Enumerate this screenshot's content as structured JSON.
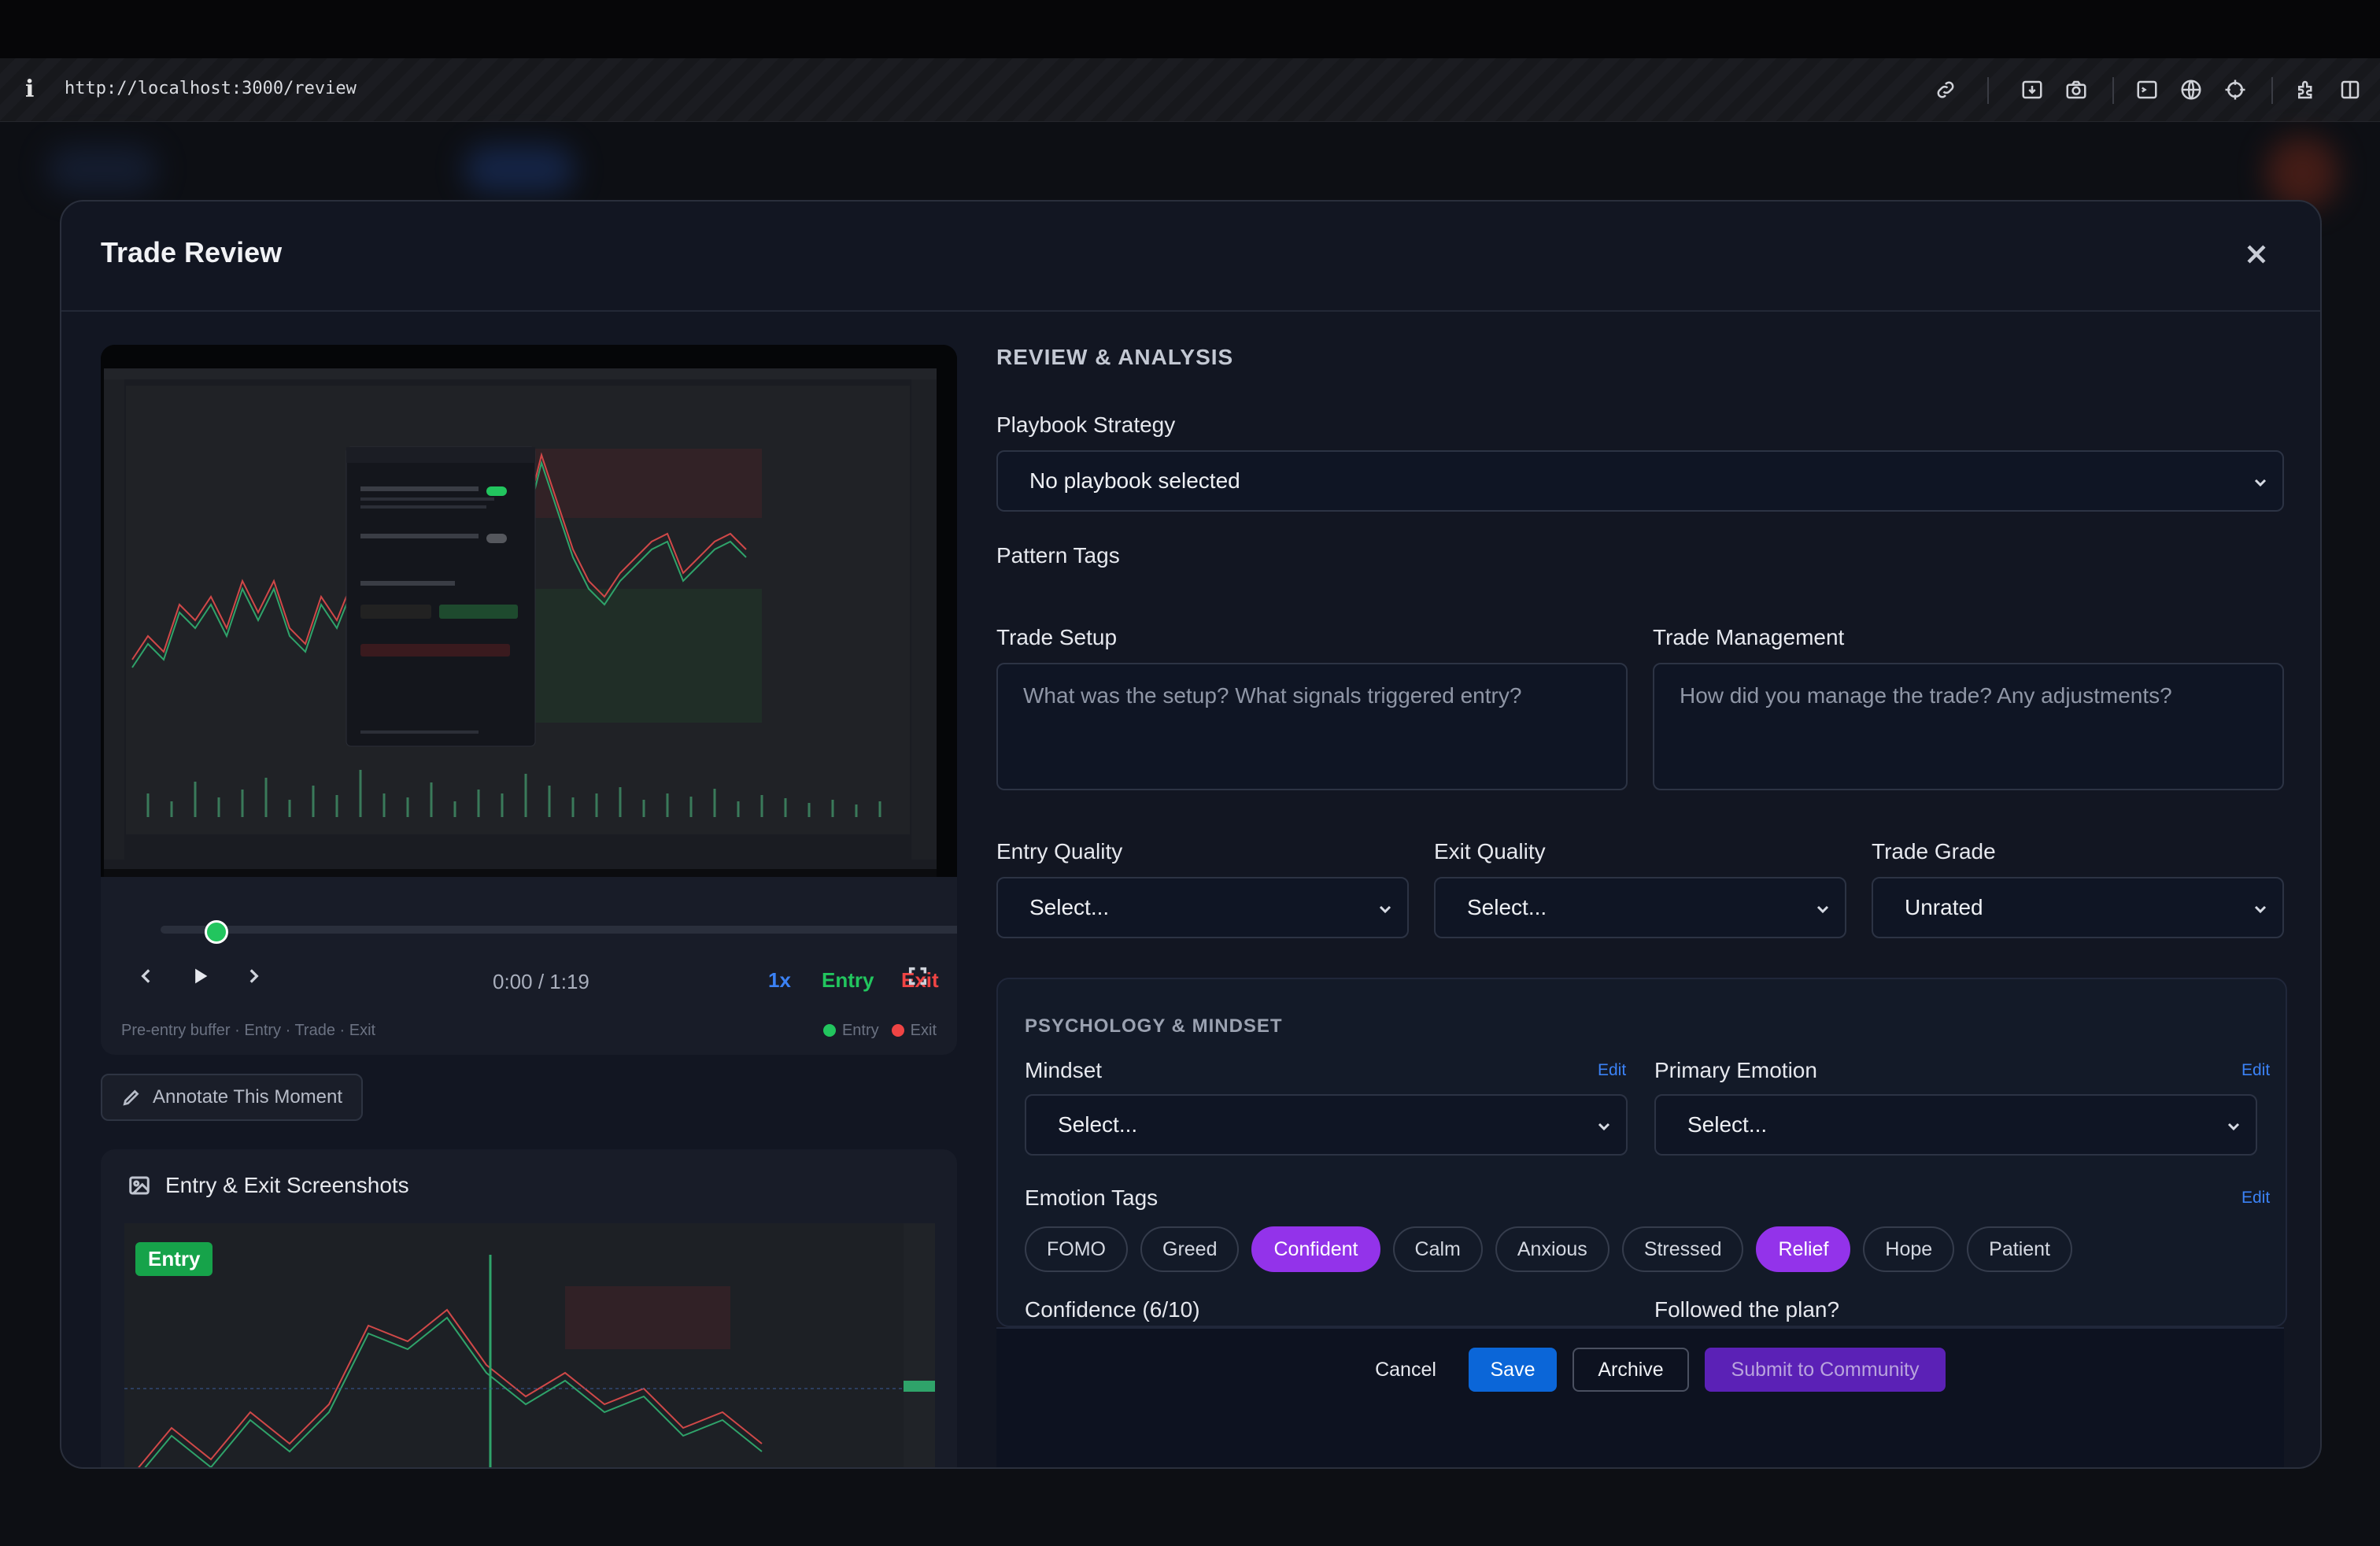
{
  "browser": {
    "info_glyph": "i",
    "url": "http://localhost:3000/review"
  },
  "modal": {
    "title": "Trade Review"
  },
  "player": {
    "time": "0:00 / 1:19",
    "speed": "1x",
    "entry_label": "Entry",
    "exit_label": "Exit",
    "caption": "Pre-entry buffer · Entry · Trade · Exit",
    "legend_entry": "Entry",
    "legend_exit": "Exit",
    "entry_color": "#22c55e",
    "exit_color": "#ef4444",
    "progress": 0
  },
  "annotate": {
    "label": "Annotate This Moment"
  },
  "screenshots": {
    "title": "Entry & Exit Screenshots",
    "entry_tag": "Entry"
  },
  "review": {
    "section_title": "REVIEW & ANALYSIS",
    "playbook": {
      "label": "Playbook Strategy",
      "value": "No playbook selected"
    },
    "pattern_tags": {
      "label": "Pattern Tags"
    },
    "trade_setup": {
      "label": "Trade Setup",
      "placeholder": "What was the setup? What signals triggered entry?"
    },
    "trade_management": {
      "label": "Trade Management",
      "placeholder": "How did you manage the trade? Any adjustments?"
    },
    "entry_quality": {
      "label": "Entry Quality",
      "value": "Select..."
    },
    "exit_quality": {
      "label": "Exit Quality",
      "value": "Select..."
    },
    "trade_grade": {
      "label": "Trade Grade",
      "value": "Unrated"
    }
  },
  "psychology": {
    "title": "PSYCHOLOGY & MINDSET",
    "mindset": {
      "label": "Mindset",
      "value": "Select...",
      "edit": "Edit"
    },
    "primary_emotion": {
      "label": "Primary Emotion",
      "value": "Select...",
      "edit": "Edit"
    },
    "emotion_tags": {
      "label": "Emotion Tags",
      "edit": "Edit",
      "tags": [
        {
          "label": "FOMO",
          "selected": false
        },
        {
          "label": "Greed",
          "selected": false
        },
        {
          "label": "Confident",
          "selected": true
        },
        {
          "label": "Calm",
          "selected": false
        },
        {
          "label": "Anxious",
          "selected": false
        },
        {
          "label": "Stressed",
          "selected": false
        },
        {
          "label": "Relief",
          "selected": true
        },
        {
          "label": "Hope",
          "selected": false
        },
        {
          "label": "Patient",
          "selected": false
        }
      ]
    },
    "confidence_label": "Confidence (6/10)",
    "followed_plan_label": "Followed the plan?"
  },
  "footer": {
    "cancel": "Cancel",
    "save": "Save",
    "archive": "Archive",
    "submit": "Submit to Community"
  },
  "colors": {
    "accent_blue": "#0b66d8",
    "chip_selected": "#9333ea",
    "submit_purple": "#5b21b6"
  }
}
